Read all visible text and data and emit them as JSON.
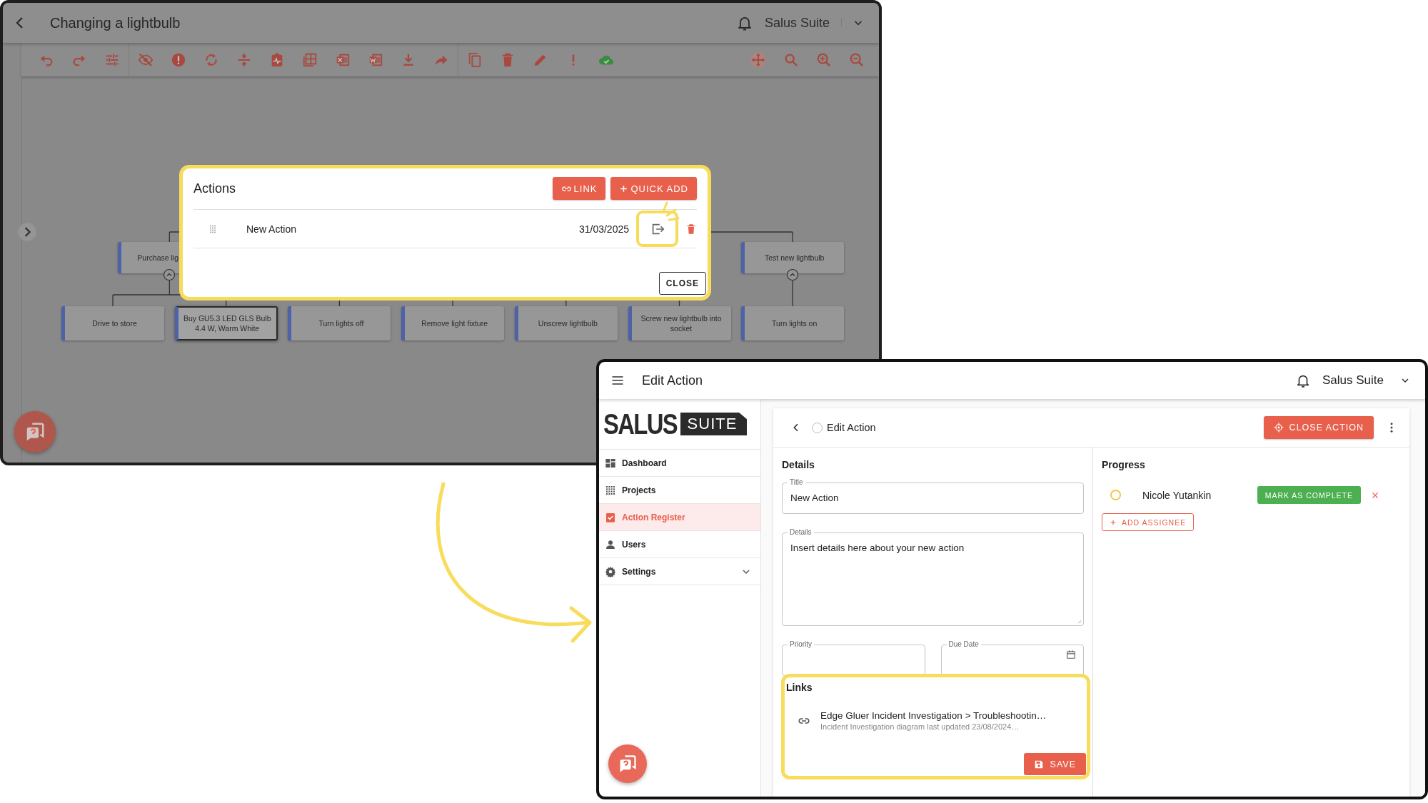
{
  "diagram_window": {
    "title": "Changing a lightbulb",
    "account": "Salus Suite",
    "nodes": [
      {
        "label": "Purchase lig",
        "expanded": true,
        "children": [
          {
            "label": "Drive to store",
            "selected": false
          },
          {
            "label": "Buy GU5.3 LED GLS Bulb 4.4 W, Warm White",
            "selected": true
          }
        ]
      },
      {
        "children": [
          {
            "label": "Turn lights off",
            "selected": false
          },
          {
            "label": "Remove light fixture",
            "selected": false
          },
          {
            "label": "Unscrew lightbulb",
            "selected": false
          },
          {
            "label": "Screw new lightbulb into socket",
            "selected": false
          }
        ]
      },
      {
        "label": "Test new lightbulb",
        "expanded": true,
        "children": [
          {
            "label": "Turn lights on",
            "selected": false
          }
        ]
      }
    ]
  },
  "actions_dialog": {
    "title": "Actions",
    "link_button": "LINK",
    "quick_add_button": "QUICK ADD",
    "rows": [
      {
        "name": "New Action",
        "date": "31/03/2025"
      }
    ],
    "close_button": "CLOSE"
  },
  "edit_window": {
    "title": "Edit Action",
    "account": "Salus Suite",
    "logo": {
      "name": "SALUS",
      "tag": "SUITE"
    },
    "nav": [
      {
        "kind": "dashboard",
        "label": "Dashboard",
        "selected": false
      },
      {
        "kind": "projects",
        "label": "Projects",
        "selected": false
      },
      {
        "kind": "register",
        "label": "Action Register",
        "selected": true
      },
      {
        "kind": "users",
        "label": "Users",
        "selected": false
      },
      {
        "kind": "settings",
        "label": "Settings",
        "selected": false,
        "expanded": false
      }
    ],
    "page": {
      "title": "Edit Action",
      "completed": false,
      "close_button": "CLOSE ACTION"
    },
    "details": {
      "heading": "Details",
      "title_field": {
        "label": "Title",
        "value": "New Action"
      },
      "details_field": {
        "label": "Details",
        "value": "Insert details here about your new action"
      },
      "priority_field": {
        "label": "Priority"
      },
      "due_date_field": {
        "label": "Due Date"
      }
    },
    "progress": {
      "heading": "Progress",
      "assignees": [
        {
          "name": "Nicole Yutankin",
          "completed": false,
          "action": "MARK AS COMPLETE"
        }
      ],
      "add_button": "ADD ASSIGNEE"
    },
    "links_panel": {
      "heading": "Links",
      "items": [
        {
          "title": "Edge Gluer Incident Investigation > Troubleshootin…",
          "subtitle": "Incident Investigation diagram last updated 23/08/2024…"
        }
      ],
      "save_button": "SAVE"
    }
  }
}
